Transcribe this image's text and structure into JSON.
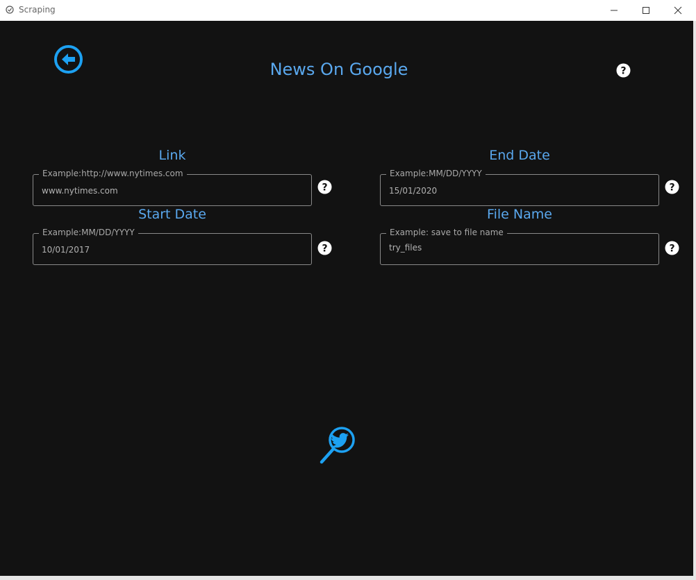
{
  "window": {
    "title": "Scraping"
  },
  "header": {
    "title": "News On Google",
    "back_icon": "arrow-left-circle-icon",
    "help_icon": "question-circle-icon"
  },
  "fields": {
    "link": {
      "label": "Link",
      "placeholder": "Example:http://www.nytimes.com",
      "value": "www.nytimes.com"
    },
    "end_date": {
      "label": "End Date",
      "placeholder": "Example:MM/DD/YYYY",
      "value": "15/01/2020"
    },
    "start_date": {
      "label": "Start Date",
      "placeholder": "Example:MM/DD/YYYY",
      "value": "10/01/2017"
    },
    "file_name": {
      "label": "File Name",
      "placeholder": "Example: save to file name",
      "value": "try_files"
    }
  },
  "action": {
    "search_icon": "twitter-search-icon"
  },
  "colors": {
    "background": "#121212",
    "accent": "#5aa8ee",
    "icon_blue": "#1da1f2",
    "field_border": "#8a8a8a",
    "field_text": "#b3b3b3"
  }
}
